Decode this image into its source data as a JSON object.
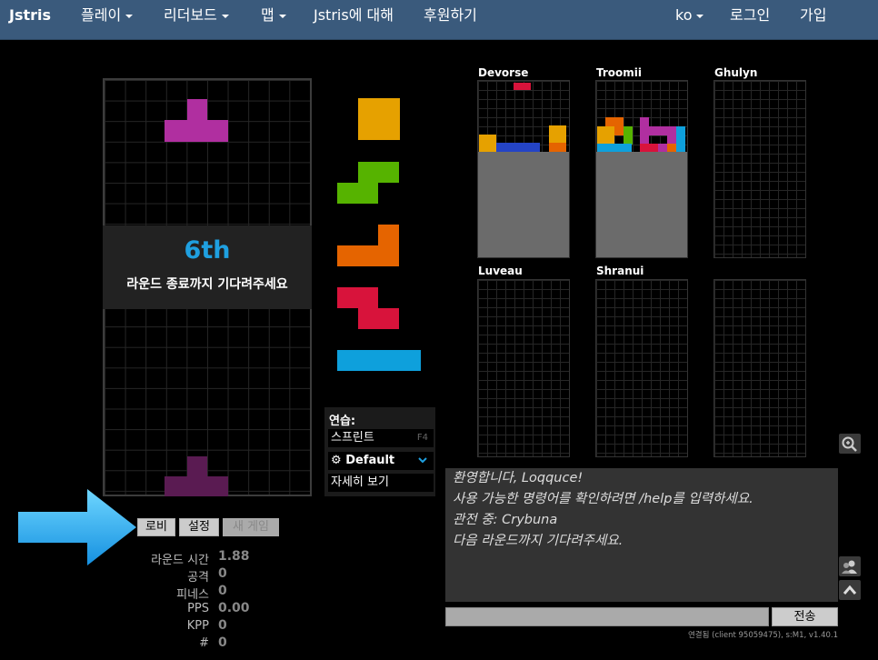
{
  "navbar": {
    "brand": "Jstris",
    "play": "플레이",
    "leaderboard": "리더보드",
    "maps": "맵",
    "about": "Jstris에 대해",
    "donate": "후원하기",
    "language": "ko",
    "login": "로그인",
    "register": "가입"
  },
  "game": {
    "rank": "6th",
    "wait_message": "라운드 종료까지 기다려주세요"
  },
  "practice": {
    "title": "연습:",
    "sprint": "스프린트",
    "sprint_key": "F4",
    "skin_default": "Default",
    "details": "자세히 보기"
  },
  "buttons": {
    "lobby": "로비",
    "settings": "설정",
    "new_game": "새 게임"
  },
  "stats": [
    {
      "label": "라운드 시간",
      "value": "1.88"
    },
    {
      "label": "공격",
      "value": "0"
    },
    {
      "label": "피네스",
      "value": "0"
    },
    {
      "label": "PPS",
      "value": "0.00"
    },
    {
      "label": "KPP",
      "value": "0"
    },
    {
      "label": "#",
      "value": "0"
    }
  ],
  "opponents": [
    {
      "name": "Devorse"
    },
    {
      "name": "Troomii"
    },
    {
      "name": "Ghulyn"
    },
    {
      "name": "Luveau"
    },
    {
      "name": "Shranui"
    },
    {
      "name": ""
    }
  ],
  "chat": {
    "messages": [
      "환영합니다, Loqquce!",
      "사용 가능한 명령어를 확인하려면 /help를 입력하세요.",
      "관전 중: Crybuna",
      "다음 라운드까지 기다려주세요."
    ],
    "send": "전송",
    "connection": "연결됨 (client 95059475), s:M1, v1.40.1"
  },
  "icons": {
    "zoom": "zoom-icon",
    "friends": "friends-icon",
    "scroll_up": "chevron-up-icon",
    "settings_gear": "gear-icon",
    "dropdown": "chevron-down-icon",
    "pointer_arrow": "arrow-right-icon"
  },
  "colors": {
    "navbar": "#3a5a7c",
    "T": "#b02fa0",
    "O": "#e6a100",
    "S": "#56b300",
    "L": "#e56400",
    "Z": "#d8133b",
    "I": "#0ea0dc",
    "J": "#2444c6",
    "garbage": "#6b6b6b",
    "accent": "#1fa0e0"
  }
}
